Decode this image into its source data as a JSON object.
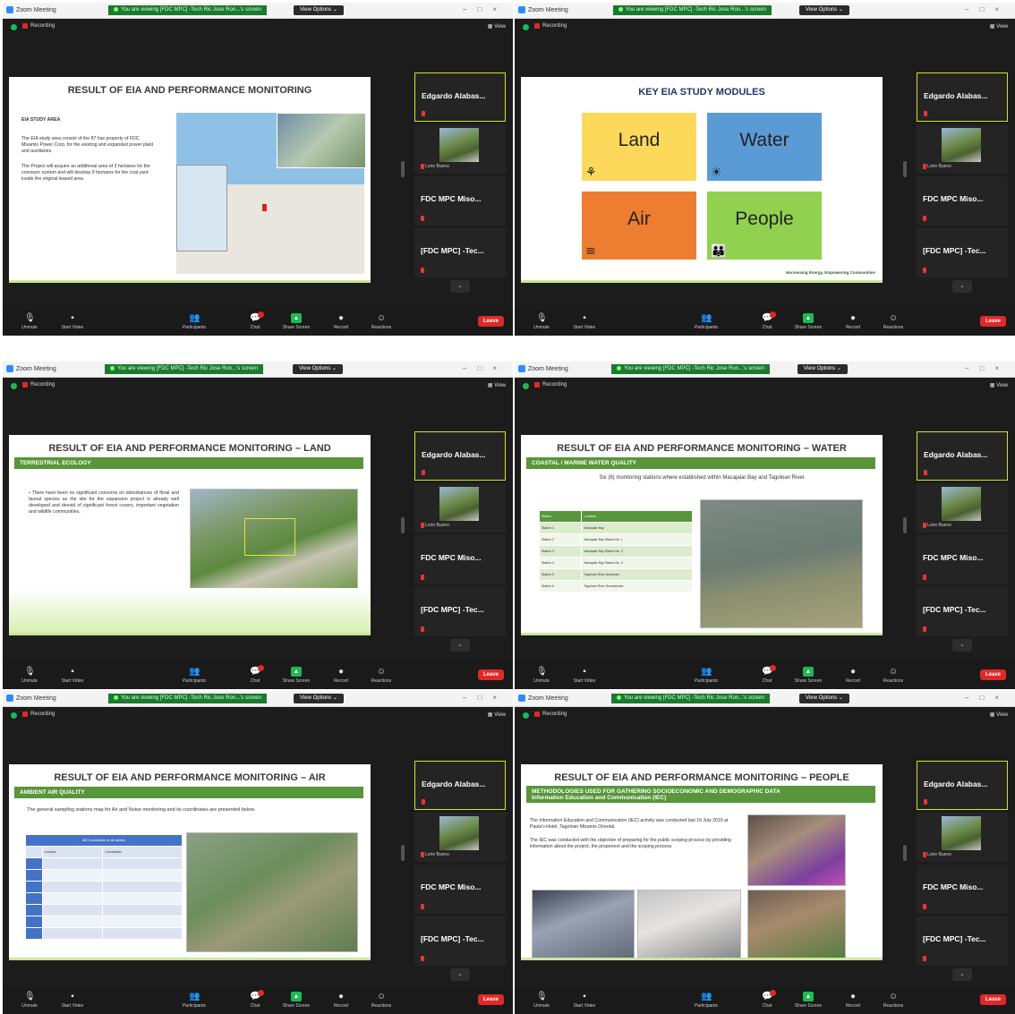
{
  "window": {
    "app_title": "Zoom Meeting",
    "banner_text": "You are viewing [FDC MPC] -Tech Ric Jose Ron...'s screen",
    "view_options": "View Options ⌄",
    "recording": "Recording",
    "view_label": "View"
  },
  "participants": {
    "tile1": "Edgardo Alabas...",
    "tile2_caption": "Lorie Bueno",
    "tile3": "FDC MPC Miso...",
    "tile4": "[FDC MPC] -Tec..."
  },
  "toolbar": {
    "unmute": "Unmute",
    "start_video": "Start Video",
    "participants": "Participants",
    "participants_count": "31",
    "chat": "Chat",
    "share": "Share Screen",
    "record": "Record",
    "reactions": "Reactions",
    "leave": "Leave"
  },
  "slides": {
    "s1": {
      "title": "RESULT OF EIA AND PERFORMANCE MONITORING",
      "heading": "EIA STUDY AREA",
      "p1": "The EIA study area consist of the 87 has property of FDC Misamis Power Corp. for the existing and expanded power plant and auxiliaries.",
      "p2": "The Project will acquire an additional area of 3 hectares for the conveyor system and will develop 9 hectares for the coal yard inside the original leased area"
    },
    "s2": {
      "title": "KEY EIA STUDY MODULES",
      "m1": "Land",
      "m2": "Water",
      "m3": "Air",
      "m4": "People",
      "tagline": "Harnessing Energy, Empowering Communities"
    },
    "s3": {
      "title": "RESULT OF EIA AND PERFORMANCE MONITORING – LAND",
      "bar": "TERRESTRIAL ECOLOGY",
      "bullet": "There have been no significant concerns on disturbances of floral and faunal species as the site for the expansion project is already well developed and devoid of significant forest covers, important vegetation and wildlife communities."
    },
    "s4": {
      "title": "RESULT OF EIA AND PERFORMANCE MONITORING – WATER",
      "bar": "COASTAL / MARINE WATER QUALITY",
      "sub": "Six (6) monitoring stations where established within Macajalar Bay and Tagoloan River",
      "th1": "Station",
      "th2": "Location",
      "rows": [
        [
          "Station 1",
          "Macajalar Bay"
        ],
        [
          "Station 2",
          "Macajalar Bay Station No. 1"
        ],
        [
          "Station 3",
          "Macajalar Bay Station No. 2"
        ],
        [
          "Station 4",
          "Macajalar Bay Station No. 3"
        ],
        [
          "Station 5",
          "Tagoloan River Upstream"
        ],
        [
          "Station 6",
          "Tagoloan River Downstream"
        ]
      ]
    },
    "s5": {
      "title": "RESULT OF EIA AND PERFORMANCE MONITORING – AIR",
      "bar": "AMBIENT AIR QUALITY",
      "sub": "The general sampling stations map for Air and Noise monitoring and its coordinates are presented below.",
      "caption": "AIR Coordinates for all stations",
      "th1": "Location",
      "th2": "Coordinates"
    },
    "s6": {
      "title": "RESULT OF EIA AND PERFORMANCE MONITORING – PEOPLE",
      "bar1": "METHODOLOGIES USED FOR GATHERING SOCIOECONOMIC AND DEMOGRAPHIC DATA",
      "bar2": "Information Education and Communication (IEC)",
      "p1": "The Information Education and Communication (IEC) activity was conducted last 16 July 2019 at Paula's Hotel, Tagoloan Misamis Oriental.",
      "p2": "The IEC was conducted with the objective of preparing for the public scoping process by providing information about the project, the proponent and the scoping process"
    }
  },
  "colors": {
    "zoom_bg": "#1c1c1c",
    "share_green": "#1db954",
    "leave_red": "#e02828",
    "slide_green": "#57963a",
    "land": "#fcd95a",
    "water": "#5b9bd5",
    "air": "#ed7d31",
    "people": "#92d050"
  }
}
